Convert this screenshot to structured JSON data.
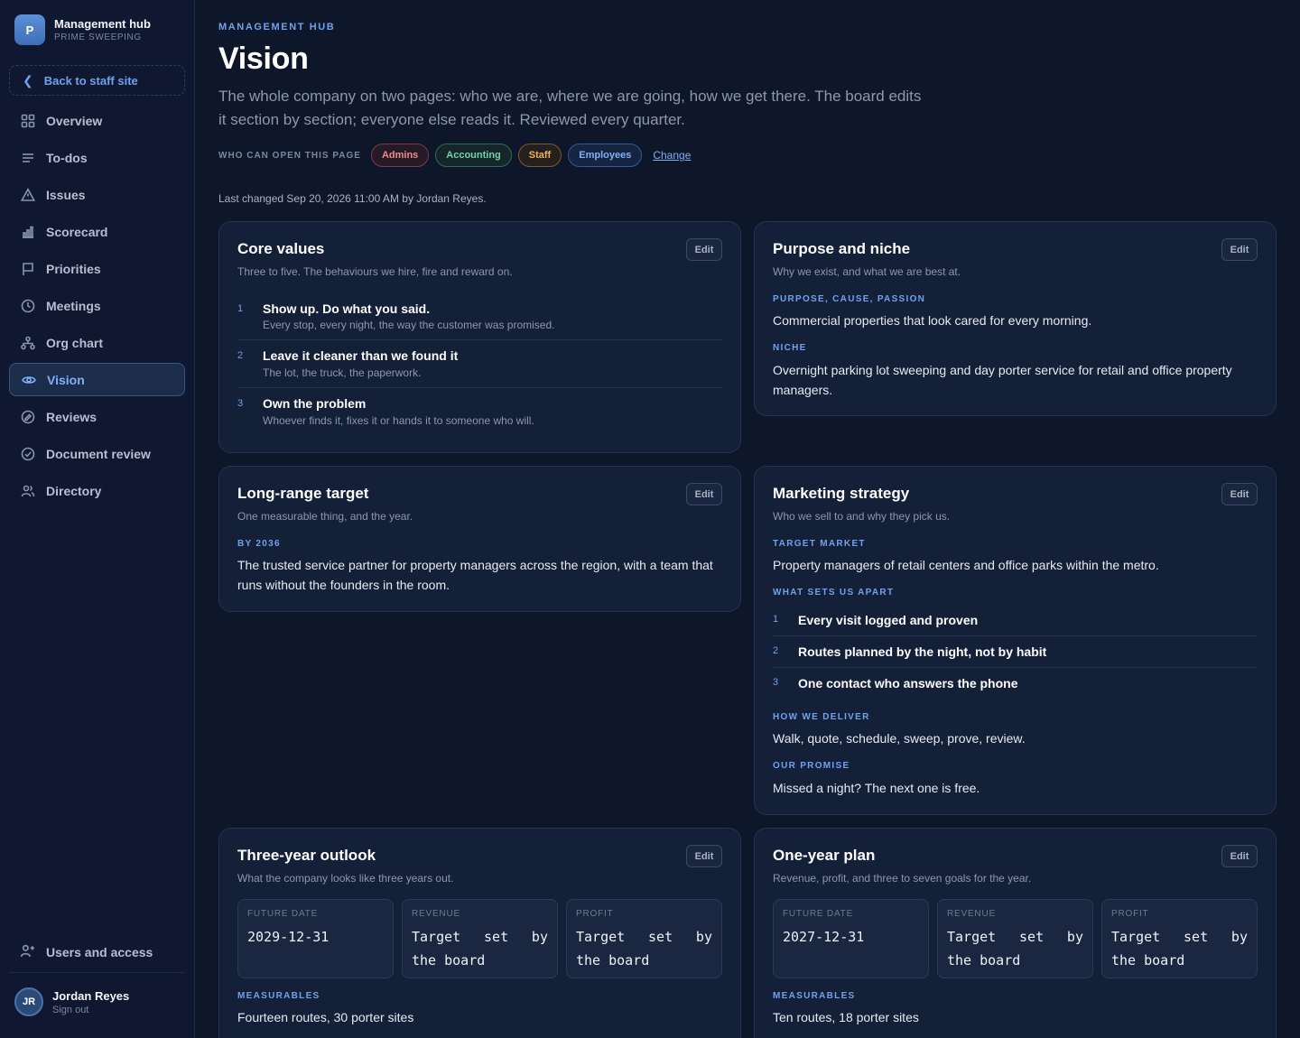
{
  "brand": {
    "logo_letter": "P",
    "title": "Management hub",
    "subtitle": "PRIME SWEEPING"
  },
  "sidebar": {
    "back_label": "Back to staff site",
    "items": [
      {
        "label": "Overview",
        "icon": "grid-icon"
      },
      {
        "label": "To-dos",
        "icon": "list-icon"
      },
      {
        "label": "Issues",
        "icon": "warning-icon"
      },
      {
        "label": "Scorecard",
        "icon": "bar-chart-icon"
      },
      {
        "label": "Priorities",
        "icon": "flag-icon"
      },
      {
        "label": "Meetings",
        "icon": "clock-icon"
      },
      {
        "label": "Org chart",
        "icon": "org-chart-icon"
      },
      {
        "label": "Vision",
        "icon": "eye-icon",
        "active": true
      },
      {
        "label": "Reviews",
        "icon": "review-icon"
      },
      {
        "label": "Document review",
        "icon": "check-circle-icon"
      },
      {
        "label": "Directory",
        "icon": "people-icon"
      }
    ],
    "users_access": "Users and access",
    "user": {
      "initials": "JR",
      "name": "Jordan Reyes",
      "action": "Sign out"
    }
  },
  "header": {
    "eyebrow": "MANAGEMENT HUB",
    "title": "Vision",
    "lede": "The whole company on two pages: who we are, where we are going, how we get there. The board edits it section by section; everyone else reads it. Reviewed every quarter.",
    "access_label": "WHO CAN OPEN THIS PAGE",
    "access": [
      "Admins",
      "Accounting",
      "Staff",
      "Employees"
    ],
    "change": "Change",
    "last_changed": "Last changed Sep 20, 2026 11:00 AM by Jordan Reyes."
  },
  "edit_label": "Edit",
  "core_values": {
    "title": "Core values",
    "subtitle": "Three to five. The behaviours we hire, fire and reward on.",
    "items": [
      {
        "num": "1",
        "title": "Show up. Do what you said.",
        "desc": "Every stop, every night, the way the customer was promised."
      },
      {
        "num": "2",
        "title": "Leave it cleaner than we found it",
        "desc": "The lot, the truck, the paperwork."
      },
      {
        "num": "3",
        "title": "Own the problem",
        "desc": "Whoever finds it, fixes it or hands it to someone who will."
      }
    ]
  },
  "purpose": {
    "title": "Purpose and niche",
    "subtitle": "Why we exist, and what we are best at.",
    "purpose_label": "PURPOSE, CAUSE, PASSION",
    "purpose_text": "Commercial properties that look cared for every morning.",
    "niche_label": "NICHE",
    "niche_text": "Overnight parking lot sweeping and day porter service for retail and office property managers."
  },
  "long_range": {
    "title": "Long-range target",
    "subtitle": "One measurable thing, and the year.",
    "label": "BY 2036",
    "text": "The trusted service partner for property managers across the region, with a team that runs without the founders in the room."
  },
  "marketing": {
    "title": "Marketing strategy",
    "subtitle": "Who we sell to and why they pick us.",
    "target_label": "TARGET MARKET",
    "target_text": "Property managers of retail centers and office parks within the metro.",
    "apart_label": "WHAT SETS US APART",
    "apart": [
      {
        "num": "1",
        "text": "Every visit logged and proven"
      },
      {
        "num": "2",
        "text": "Routes planned by the night, not by habit"
      },
      {
        "num": "3",
        "text": "One contact who answers the phone"
      }
    ],
    "deliver_label": "HOW WE DELIVER",
    "deliver_text": "Walk, quote, schedule, sweep, prove, review.",
    "promise_label": "OUR PROMISE",
    "promise_text": "Missed a night? The next one is free."
  },
  "three_year": {
    "title": "Three-year outlook",
    "subtitle": "What the company looks like three years out.",
    "future_label": "FUTURE DATE",
    "future_value": "2029-12-31",
    "revenue_label": "REVENUE",
    "revenue_value": "Target set by the board",
    "profit_label": "PROFIT",
    "profit_value": "Target set by the board",
    "measurables_label": "MEASURABLES",
    "measurables_text": "Fourteen routes, 30 porter sites"
  },
  "one_year": {
    "title": "One-year plan",
    "subtitle": "Revenue, profit, and three to seven goals for the year.",
    "future_label": "FUTURE DATE",
    "future_value": "2027-12-31",
    "revenue_label": "REVENUE",
    "revenue_value": "Target set by the board",
    "profit_label": "PROFIT",
    "profit_value": "Target set by the board",
    "measurables_label": "MEASURABLES",
    "measurables_text": "Ten routes, 18 porter sites"
  }
}
